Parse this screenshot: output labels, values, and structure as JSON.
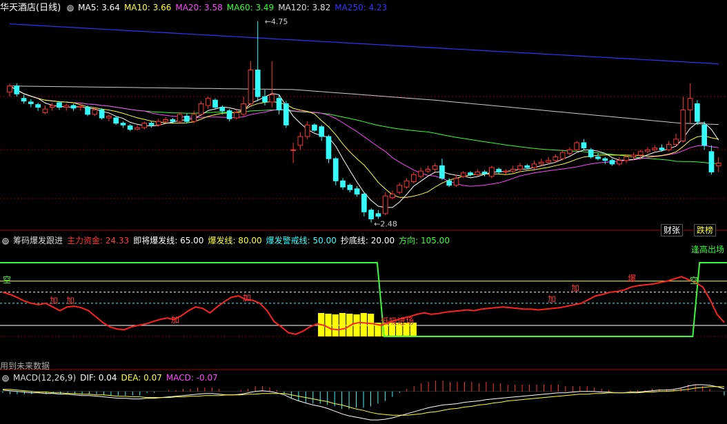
{
  "panel1": {
    "title": "华天酒店(日线)",
    "indicators": [
      {
        "label": "MA5: 3.64",
        "color": "#ffffff"
      },
      {
        "label": "MA10: 3.66",
        "color": "#ffff33"
      },
      {
        "label": "MA20: 3.58",
        "color": "#ff44ff"
      },
      {
        "label": "MA60: 3.49",
        "color": "#33ff33"
      },
      {
        "label": "MA120: 3.82",
        "color": "#dddddd"
      },
      {
        "label": "MA250: 4.23",
        "color": "#3333ff"
      }
    ],
    "high_label": "4.75",
    "low_label": "2.48",
    "tags": [
      {
        "label": "财张",
        "color": "#ffffff"
      },
      {
        "label": "跌榜",
        "color": "#ffff33"
      }
    ]
  },
  "panel2": {
    "title": "筹码爆发跟进",
    "indicators": [
      {
        "label": "主力资金: 24.33",
        "color": "#ff3333"
      },
      {
        "label": "即将爆发线: 65.00",
        "color": "#ffffff"
      },
      {
        "label": "爆发线: 80.00",
        "color": "#ffff33"
      },
      {
        "label": "爆发警戒线: 50.00",
        "color": "#33ffff"
      },
      {
        "label": "抄底线: 20.00",
        "color": "#ffffff"
      },
      {
        "label": "方向: 105.00",
        "color": "#33ff33"
      }
    ],
    "annotations": [
      {
        "text": "空",
        "color": "#33ff33"
      },
      {
        "text": "加",
        "color": "#ff3333"
      },
      {
        "text": "加",
        "color": "#ff3333"
      },
      {
        "text": "加",
        "color": "#ff3333"
      },
      {
        "text": "加",
        "color": "#ff3333"
      },
      {
        "text": "低吸进场",
        "color": "#ff3333"
      },
      {
        "text": "加",
        "color": "#ff3333"
      },
      {
        "text": "加",
        "color": "#ff3333"
      },
      {
        "text": "爆",
        "color": "#ff3333"
      },
      {
        "text": "空",
        "color": "#33ff33"
      },
      {
        "text": "逢高出场",
        "color": "#33ff33"
      }
    ],
    "footer": "用到未来数据"
  },
  "panel3": {
    "title": "MACD(12,26,9)",
    "indicators": [
      {
        "label": "DIF: 0.04",
        "color": "#ffffff"
      },
      {
        "label": "DEA: 0.07",
        "color": "#ffff33"
      },
      {
        "label": "MACD: -0.07",
        "color": "#ff44ff"
      }
    ]
  },
  "colors": {
    "up": "#ff3333",
    "down": "#33ffff",
    "grid": "#8b0000"
  },
  "chart_data": [
    {
      "type": "candlestick",
      "title": "华天酒店(日线)",
      "ylim": [
        2.4,
        4.85
      ],
      "candles": [
        [
          3.95,
          4.02,
          3.9,
          4.05
        ],
        [
          4.02,
          3.93,
          3.9,
          4.05
        ],
        [
          3.88,
          3.85,
          3.82,
          3.92
        ],
        [
          3.84,
          3.82,
          3.78,
          3.87
        ],
        [
          3.81,
          3.78,
          3.74,
          3.83
        ],
        [
          3.72,
          3.76,
          3.7,
          3.8
        ],
        [
          3.78,
          3.8,
          3.74,
          3.83
        ],
        [
          3.83,
          3.78,
          3.75,
          3.85
        ],
        [
          3.78,
          3.8,
          3.74,
          3.82
        ],
        [
          3.8,
          3.77,
          3.74,
          3.82
        ],
        [
          3.78,
          3.79,
          3.74,
          3.82
        ],
        [
          3.78,
          3.7,
          3.68,
          3.8
        ],
        [
          3.7,
          3.75,
          3.68,
          3.78
        ],
        [
          3.75,
          3.66,
          3.64,
          3.77
        ],
        [
          3.66,
          3.68,
          3.62,
          3.7
        ],
        [
          3.66,
          3.6,
          3.58,
          3.68
        ],
        [
          3.6,
          3.58,
          3.55,
          3.62
        ],
        [
          3.57,
          3.53,
          3.51,
          3.59
        ],
        [
          3.53,
          3.55,
          3.52,
          3.58
        ],
        [
          3.55,
          3.6,
          3.53,
          3.62
        ],
        [
          3.6,
          3.58,
          3.55,
          3.62
        ],
        [
          3.58,
          3.62,
          3.56,
          3.65
        ],
        [
          3.62,
          3.64,
          3.6,
          3.67
        ],
        [
          3.64,
          3.62,
          3.6,
          3.66
        ],
        [
          3.62,
          3.7,
          3.6,
          3.72
        ],
        [
          3.68,
          3.62,
          3.6,
          3.71
        ],
        [
          3.62,
          3.7,
          3.6,
          3.74
        ],
        [
          3.7,
          3.82,
          3.68,
          3.85
        ],
        [
          3.8,
          3.88,
          3.76,
          3.9
        ],
        [
          3.86,
          3.78,
          3.76,
          3.88
        ],
        [
          3.78,
          3.74,
          3.7,
          3.8
        ],
        [
          3.74,
          3.65,
          3.62,
          3.76
        ],
        [
          3.66,
          3.72,
          3.64,
          3.75
        ],
        [
          3.7,
          3.82,
          3.68,
          3.9
        ],
        [
          3.82,
          4.2,
          3.8,
          4.3
        ],
        [
          4.2,
          3.9,
          3.85,
          4.75
        ],
        [
          3.9,
          3.84,
          3.8,
          3.98
        ],
        [
          3.84,
          3.92,
          3.78,
          4.3
        ],
        [
          3.88,
          3.75,
          3.7,
          3.92
        ],
        [
          3.82,
          3.58,
          3.55,
          3.85
        ],
        [
          3.3,
          3.3,
          3.15,
          3.38
        ],
        [
          3.35,
          3.45,
          3.3,
          3.5
        ],
        [
          3.45,
          3.58,
          3.42,
          3.62
        ],
        [
          3.58,
          3.52,
          3.5,
          3.6
        ],
        [
          3.56,
          3.45,
          3.4,
          3.58
        ],
        [
          3.45,
          3.2,
          3.15,
          3.47
        ],
        [
          3.2,
          2.95,
          2.9,
          3.22
        ],
        [
          2.95,
          2.88,
          2.85,
          2.98
        ],
        [
          2.9,
          2.85,
          2.82,
          2.92
        ],
        [
          2.86,
          2.8,
          2.77,
          2.89
        ],
        [
          2.8,
          2.6,
          2.55,
          2.82
        ],
        [
          2.62,
          2.52,
          2.48,
          2.64
        ],
        [
          2.58,
          2.55,
          2.52,
          2.62
        ],
        [
          2.58,
          2.78,
          2.56,
          2.82
        ],
        [
          2.76,
          2.8,
          2.74,
          2.84
        ],
        [
          2.82,
          2.9,
          2.8,
          2.93
        ],
        [
          2.88,
          2.95,
          2.86,
          2.98
        ],
        [
          2.94,
          3.02,
          2.92,
          3.05
        ],
        [
          3.0,
          3.06,
          2.98,
          3.1
        ],
        [
          3.06,
          3.08,
          3.04,
          3.12
        ],
        [
          3.08,
          3.12,
          3.05,
          3.15
        ],
        [
          3.12,
          2.98,
          2.96,
          3.2
        ],
        [
          2.95,
          2.9,
          2.88,
          2.98
        ],
        [
          2.9,
          2.98,
          2.88,
          3.02
        ],
        [
          3.0,
          3.04,
          2.98,
          3.06
        ],
        [
          3.04,
          3.02,
          3.0,
          3.06
        ],
        [
          3.02,
          3.05,
          3.0,
          3.08
        ],
        [
          3.05,
          3.03,
          3.0,
          3.07
        ],
        [
          3.0,
          3.1,
          2.98,
          3.12
        ],
        [
          3.08,
          3.05,
          3.03,
          3.1
        ],
        [
          3.05,
          3.06,
          3.02,
          3.08
        ],
        [
          3.06,
          3.08,
          3.04,
          3.12
        ],
        [
          3.08,
          3.12,
          3.05,
          3.15
        ],
        [
          3.12,
          3.1,
          3.08,
          3.14
        ],
        [
          3.1,
          3.14,
          3.08,
          3.18
        ],
        [
          3.14,
          3.16,
          3.12,
          3.2
        ],
        [
          3.16,
          3.18,
          3.14,
          3.22
        ],
        [
          3.18,
          3.22,
          3.16,
          3.25
        ],
        [
          3.2,
          3.27,
          3.18,
          3.3
        ],
        [
          3.26,
          3.3,
          3.24,
          3.33
        ],
        [
          3.3,
          3.38,
          3.28,
          3.4
        ],
        [
          3.38,
          3.32,
          3.3,
          3.42
        ],
        [
          3.3,
          3.22,
          3.2,
          3.32
        ],
        [
          3.22,
          3.2,
          3.18,
          3.26
        ],
        [
          3.2,
          3.18,
          3.14,
          3.22
        ],
        [
          3.18,
          3.14,
          3.12,
          3.2
        ],
        [
          3.14,
          3.18,
          3.12,
          3.22
        ],
        [
          3.18,
          3.22,
          3.15,
          3.25
        ],
        [
          3.22,
          3.24,
          3.18,
          3.27
        ],
        [
          3.24,
          3.28,
          3.2,
          3.3
        ],
        [
          3.28,
          3.3,
          3.26,
          3.33
        ],
        [
          3.3,
          3.32,
          3.28,
          3.35
        ],
        [
          3.32,
          3.3,
          3.28,
          3.36
        ],
        [
          3.3,
          3.36,
          3.28,
          3.4
        ],
        [
          3.36,
          3.42,
          3.34,
          3.48
        ],
        [
          3.4,
          3.75,
          3.38,
          3.9
        ],
        [
          3.75,
          3.88,
          3.6,
          4.05
        ],
        [
          3.82,
          3.62,
          3.58,
          3.86
        ],
        [
          3.58,
          3.35,
          3.3,
          3.62
        ],
        [
          3.28,
          3.05,
          3.02,
          3.35
        ],
        [
          3.12,
          3.15,
          3.05,
          3.22
        ]
      ]
    },
    {
      "type": "line",
      "title": "筹码爆发跟进",
      "ylim": [
        0,
        110
      ],
      "series": [
        {
          "name": "主力资金",
          "values": [
            65,
            62,
            58,
            53,
            50,
            48,
            50,
            45,
            40,
            45,
            46,
            44,
            40,
            32,
            24,
            18,
            15,
            14,
            18,
            20,
            22,
            25,
            28,
            30,
            28,
            33,
            40,
            45,
            43,
            37,
            45,
            52,
            58,
            60,
            55,
            54,
            50,
            40,
            25,
            18,
            10,
            8,
            12,
            18,
            22,
            20,
            15,
            14,
            16,
            22,
            24,
            23,
            22,
            20,
            24,
            27,
            30,
            32,
            35,
            37,
            35,
            36,
            38,
            39,
            40,
            41,
            40,
            42,
            43,
            44,
            45,
            44,
            43,
            42,
            42,
            41,
            42,
            43,
            44,
            46,
            48,
            50,
            55,
            60,
            62,
            65,
            66,
            68,
            72,
            74,
            75,
            76,
            78,
            80,
            83,
            86,
            82,
            78,
            72,
            55,
            35,
            24
          ]
        },
        {
          "name": "方向",
          "values": [
            105,
            105,
            105,
            105,
            105,
            105,
            105,
            105,
            105,
            105,
            105,
            105,
            105,
            105,
            105,
            105,
            105,
            105,
            105,
            105,
            105,
            105,
            105,
            105,
            105,
            105,
            105,
            105,
            105,
            105,
            105,
            105,
            105,
            105,
            105,
            105,
            105,
            105,
            105,
            105,
            105,
            105,
            105,
            105,
            105,
            105,
            105,
            105,
            105,
            105,
            105,
            105,
            105,
            105,
            105,
            105,
            5,
            5,
            5,
            5,
            5,
            5,
            5,
            5,
            5,
            5,
            5,
            5,
            5,
            5,
            5,
            5,
            5,
            5,
            5,
            5,
            5,
            5,
            5,
            5,
            5,
            5,
            5,
            5,
            5,
            5,
            5,
            5,
            5,
            5,
            5,
            5,
            5,
            5,
            5,
            5,
            5,
            5,
            5,
            5,
            5,
            5,
            105,
            105,
            105,
            105,
            105
          ]
        }
      ],
      "reference_lines": [
        {
          "name": "即将爆发线",
          "value": 65
        },
        {
          "name": "爆发线",
          "value": 80
        },
        {
          "name": "爆发警戒线",
          "value": 50
        },
        {
          "name": "抄底线",
          "value": 20
        }
      ]
    },
    {
      "type": "bar",
      "title": "MACD(12,26,9)",
      "ylim": [
        -0.45,
        0.12
      ],
      "series": [
        {
          "name": "DIF",
          "values": [
            0.02,
            0.01,
            0.0,
            -0.01,
            -0.02,
            -0.02,
            -0.03,
            -0.03,
            -0.04,
            -0.04,
            -0.05,
            -0.06,
            -0.06,
            -0.07,
            -0.08,
            -0.09,
            -0.1,
            -0.1,
            -0.11,
            -0.11,
            -0.1,
            -0.1,
            -0.09,
            -0.08,
            -0.07,
            -0.06,
            -0.05,
            -0.04,
            -0.03,
            -0.03,
            -0.04,
            -0.05,
            -0.05,
            -0.04,
            -0.02,
            0.0,
            0.01,
            0.0,
            -0.02,
            -0.05,
            -0.1,
            -0.14,
            -0.17,
            -0.2,
            -0.22,
            -0.25,
            -0.29,
            -0.33,
            -0.36,
            -0.38,
            -0.4,
            -0.42,
            -0.42,
            -0.41,
            -0.39,
            -0.36,
            -0.33,
            -0.3,
            -0.27,
            -0.24,
            -0.22,
            -0.2,
            -0.19,
            -0.18,
            -0.16,
            -0.15,
            -0.14,
            -0.12,
            -0.11,
            -0.1,
            -0.09,
            -0.08,
            -0.07,
            -0.06,
            -0.05,
            -0.04,
            -0.03,
            -0.02,
            -0.02,
            -0.01,
            0.0,
            0.0,
            0.0,
            -0.01,
            -0.01,
            -0.02,
            -0.02,
            -0.01,
            -0.01,
            0.0,
            0.01,
            0.02,
            0.02,
            0.03,
            0.05,
            0.08,
            0.1,
            0.1,
            0.09,
            0.07,
            0.04
          ]
        },
        {
          "name": "DEA",
          "values": [
            0.03,
            0.03,
            0.02,
            0.01,
            0.0,
            -0.01,
            -0.01,
            -0.02,
            -0.02,
            -0.03,
            -0.03,
            -0.04,
            -0.04,
            -0.05,
            -0.05,
            -0.06,
            -0.07,
            -0.07,
            -0.08,
            -0.08,
            -0.09,
            -0.09,
            -0.09,
            -0.09,
            -0.08,
            -0.08,
            -0.07,
            -0.07,
            -0.06,
            -0.06,
            -0.06,
            -0.05,
            -0.05,
            -0.05,
            -0.04,
            -0.04,
            -0.03,
            -0.03,
            -0.03,
            -0.03,
            -0.05,
            -0.07,
            -0.09,
            -0.11,
            -0.13,
            -0.15,
            -0.18,
            -0.2,
            -0.23,
            -0.26,
            -0.28,
            -0.31,
            -0.33,
            -0.34,
            -0.35,
            -0.35,
            -0.35,
            -0.34,
            -0.33,
            -0.31,
            -0.3,
            -0.28,
            -0.26,
            -0.25,
            -0.23,
            -0.22,
            -0.2,
            -0.19,
            -0.17,
            -0.16,
            -0.14,
            -0.13,
            -0.12,
            -0.11,
            -0.1,
            -0.09,
            -0.08,
            -0.07,
            -0.06,
            -0.05,
            -0.04,
            -0.04,
            -0.03,
            -0.03,
            -0.02,
            -0.02,
            -0.02,
            -0.02,
            -0.02,
            -0.01,
            -0.01,
            0.0,
            0.0,
            0.01,
            0.02,
            0.03,
            0.05,
            0.06,
            0.07,
            0.07,
            0.07
          ]
        }
      ]
    }
  ]
}
